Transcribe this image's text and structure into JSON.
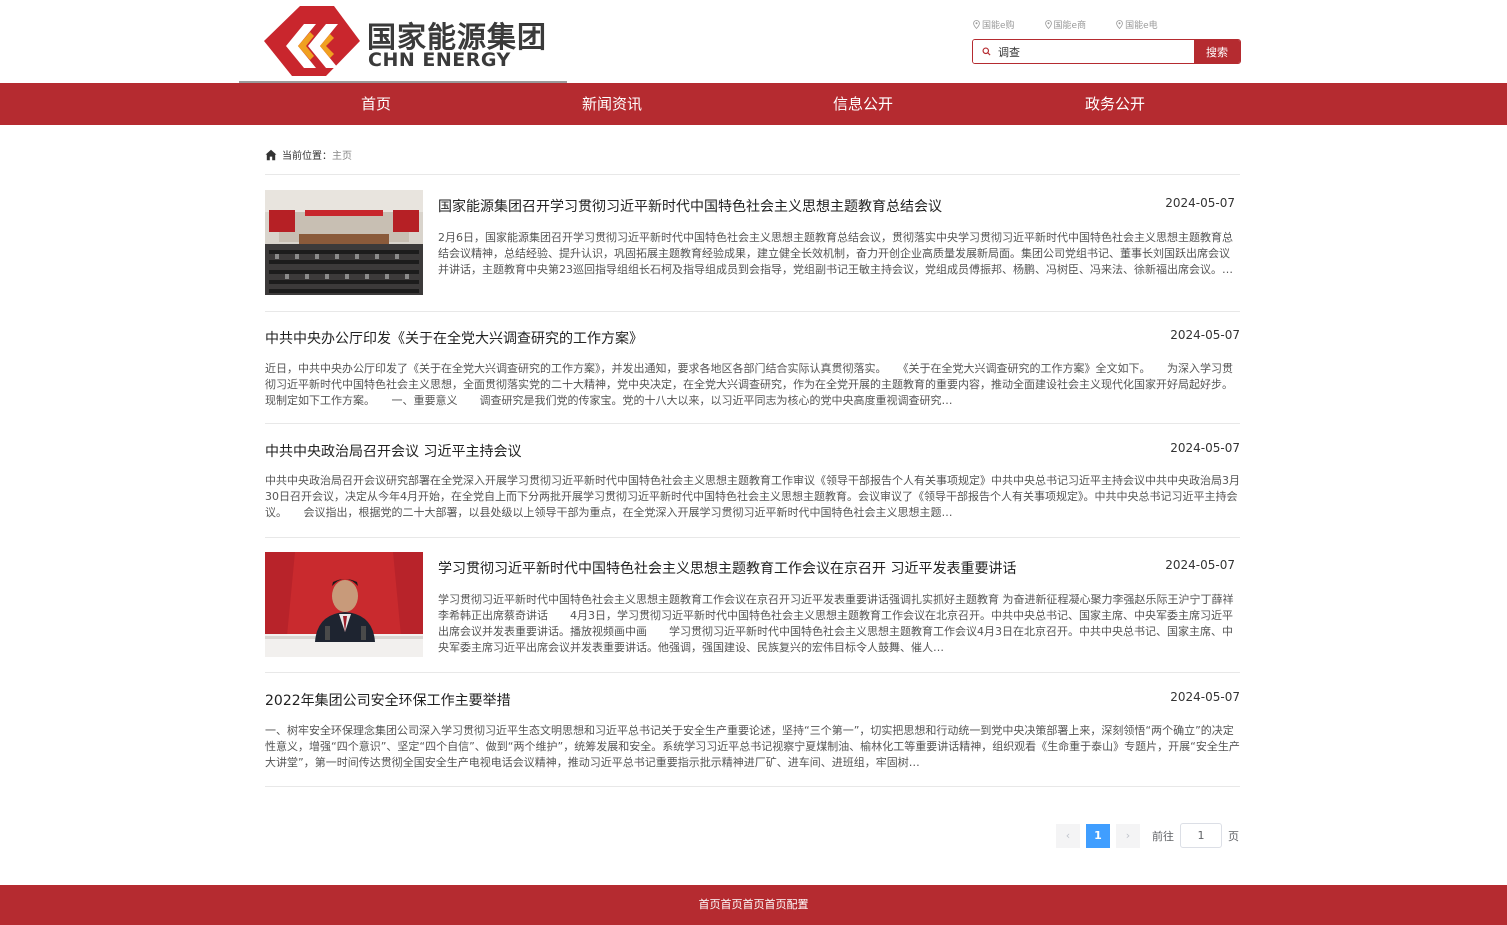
{
  "header": {
    "logo_cn": "国家能源集团",
    "logo_en": "CHN ENERGY",
    "quick_links": [
      "国能e购",
      "国能e商",
      "国能e电"
    ],
    "search": {
      "value": "调查",
      "button_label": "搜索"
    }
  },
  "nav": {
    "items": [
      "首页",
      "新闻资讯",
      "信息公开",
      "政务公开"
    ]
  },
  "breadcrumb": {
    "label": "当前位置：",
    "current": "主页"
  },
  "articles": [
    {
      "title": "国家能源集团召开学习贯彻习近平新时代中国特色社会主义思想主题教育总结会议",
      "date": "2024-05-07",
      "summary": "2月6日，国家能源集团召开学习贯彻习近平新时代中国特色社会主义思想主题教育总结会议，贯彻落实中央学习贯彻习近平新时代中国特色社会主义思想主题教育总结会议精神，总结经验、提升认识，巩固拓展主题教育经验成果，建立健全长效机制，奋力开创企业高质量发展新局面。集团公司党组书记、董事长刘国跃出席会议并讲话，主题教育中央第23巡回指导组组长石柯及指导组成员到会指导，党组副书记王敏主持会议，党组成员傅振邦、杨鹏、冯树臣、冯来法、徐新福出席会议。会议指出，集团党组坚决贯彻落实党中央决策部署，把开展主题教育作为重大政治任务，牢牢把握“学思想…",
      "has_image": true
    },
    {
      "title": "中共中央办公厅印发《关于在全党大兴调查研究的工作方案》",
      "date": "2024-05-07",
      "summary": "近日，中共中央办公厅印发了《关于在全党大兴调查研究的工作方案》，并发出通知，要求各地区各部门结合实际认真贯彻落实。　　《关于在全党大兴调查研究的工作方案》全文如下。　　为深入学习贯彻习近平新时代中国特色社会主义思想，全面贯彻落实党的二十大精神，党中央决定，在全党大兴调查研究，作为在全党开展的主题教育的重要内容，推动全面建设社会主义现代化国家开好局起好步。现制定如下工作方案。　　一、重要意义　　调查研究是我们党的传家宝。党的十八大以来，以习近平同志为核心的党中央高度重视调查研究…",
      "has_image": false
    },
    {
      "title": "中共中央政治局召开会议 习近平主持会议",
      "date": "2024-05-07",
      "summary": "中共中央政治局召开会议研究部署在全党深入开展学习贯彻习近平新时代中国特色社会主义思想主题教育工作审议《领导干部报告个人有关事项规定》中共中央总书记习近平主持会议中共中央政治局3月30日召开会议，决定从今年4月开始，在全党自上而下分两批开展学习贯彻习近平新时代中国特色社会主义思想主题教育。会议审议了《领导干部报告个人有关事项规定》。中共中央总书记习近平主持会议。　　会议指出，根据党的二十大部署，以县处级以上领导干部为重点，在全党深入开展学习贯彻习近平新时代中国特色社会主义思想主题…",
      "has_image": false
    },
    {
      "title": "学习贯彻习近平新时代中国特色社会主义思想主题教育工作会议在京召开 习近平发表重要讲话",
      "date": "2024-05-07",
      "summary": "学习贯彻习近平新时代中国特色社会主义思想主题教育工作会议在京召开习近平发表重要讲话强调扎实抓好主题教育 为奋进新征程凝心聚力李强赵乐际王沪宁丁薛祥李希韩正出席蔡奇讲话　　4月3日，学习贯彻习近平新时代中国特色社会主义思想主题教育工作会议在北京召开。中共中央总书记、国家主席、中央军委主席习近平出席会议并发表重要讲话。播放视频画中画　　学习贯彻习近平新时代中国特色社会主义思想主题教育工作会议4月3日在北京召开。中共中央总书记、国家主席、中央军委主席习近平出席会议并发表重要讲话。他强调，强国建设、民族复兴的宏伟目标令人鼓舞、催人…",
      "has_image": true
    },
    {
      "title": "2022年集团公司安全环保工作主要举措",
      "date": "2024-05-07",
      "summary": "一、树牢安全环保理念集团公司深入学习贯彻习近平生态文明思想和习近平总书记关于安全生产重要论述，坚持“三个第一”，切实把思想和行动统一到党中央决策部署上来，深刻领悟“两个确立”的决定性意义，增强“四个意识”、坚定“四个自信”、做到“两个维护”，统筹发展和安全。系统学习习近平总书记视察宁夏煤制油、榆林化工等重要讲话精神，组织观看《生命重于泰山》专题片，开展“安全生产大讲堂”，第一时间传达贯彻全国安全生产电视电话会议精神，推动习近平总书记重要指示批示精神进厂矿、进车间、进班组，牢固树…",
      "has_image": false
    }
  ],
  "pagination": {
    "prev": "‹",
    "current_page": "1",
    "next": "›",
    "goto_label": "前往",
    "goto_value": "1",
    "page_suffix": "页"
  },
  "footer": {
    "text": "首页首页首页首页配置"
  },
  "colors": {
    "brand_red": "#b52b30",
    "pager_active": "#409eff"
  }
}
